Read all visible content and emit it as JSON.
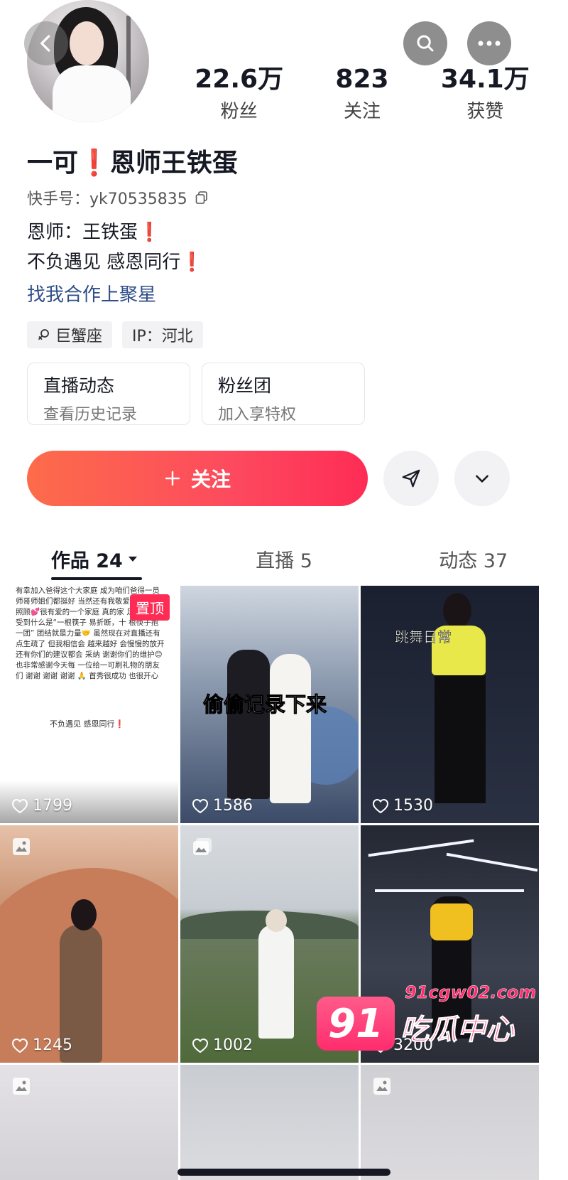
{
  "header": {
    "stats": [
      {
        "value": "22.6万",
        "label": "粉丝"
      },
      {
        "value": "823",
        "label": "关注"
      },
      {
        "value": "34.1万",
        "label": "获赞"
      }
    ]
  },
  "profile": {
    "name": "一可❗️恩师王铁蛋",
    "kuaishou_id": "快手号：yk70535835",
    "bio_line1": "恩师：王铁蛋❗️",
    "bio_line2": "不负遇见  感恩同行❗️",
    "bio_link": "找我合作上聚星",
    "tags": [
      "巨蟹座",
      "IP：河北"
    ]
  },
  "cards": [
    {
      "title": "直播动态",
      "subtitle": "查看历史记录"
    },
    {
      "title": "粉丝团",
      "subtitle": "加入享特权"
    }
  ],
  "actions": {
    "follow_label": "关注"
  },
  "tabs": [
    {
      "label": "作品 24"
    },
    {
      "label": "直播 5"
    },
    {
      "label": "动态 37"
    }
  ],
  "grid": {
    "pinned_label": "置顶",
    "tile1_text": "有幸加入爸得这个大家庭 成为咱们爸得一员 师哥师姐们都挺好 当然还有我敬爱的王 至的照顾💕很有爱的一个家庭 真的家 足 真正感受到什么是“一根筷子 易折断，十 根筷子抱一团” 团结就是力量🤝 虽然现在对直播还有点生疏了 但我相信会 越来越好 会慢慢的放开 还有你们的建议都会 采纳 谢谢你们的维护😊 也非常感谢今天每 一位给一可刷礼物的朋友们 谢谢 谢谢 谢谢 🙏 首秀很成功 也很开心",
    "tile1_footer": "不负遇见 感恩同行❗️",
    "tile2_caption": "偷偷记录下来",
    "tile3_caption": "跳舞日常",
    "likes": [
      "1799",
      "1586",
      "1530",
      "1245",
      "1002",
      "3200"
    ]
  },
  "watermark": {
    "logo": "91",
    "url": "91cgw02.com",
    "text": "吃瓜中心"
  }
}
